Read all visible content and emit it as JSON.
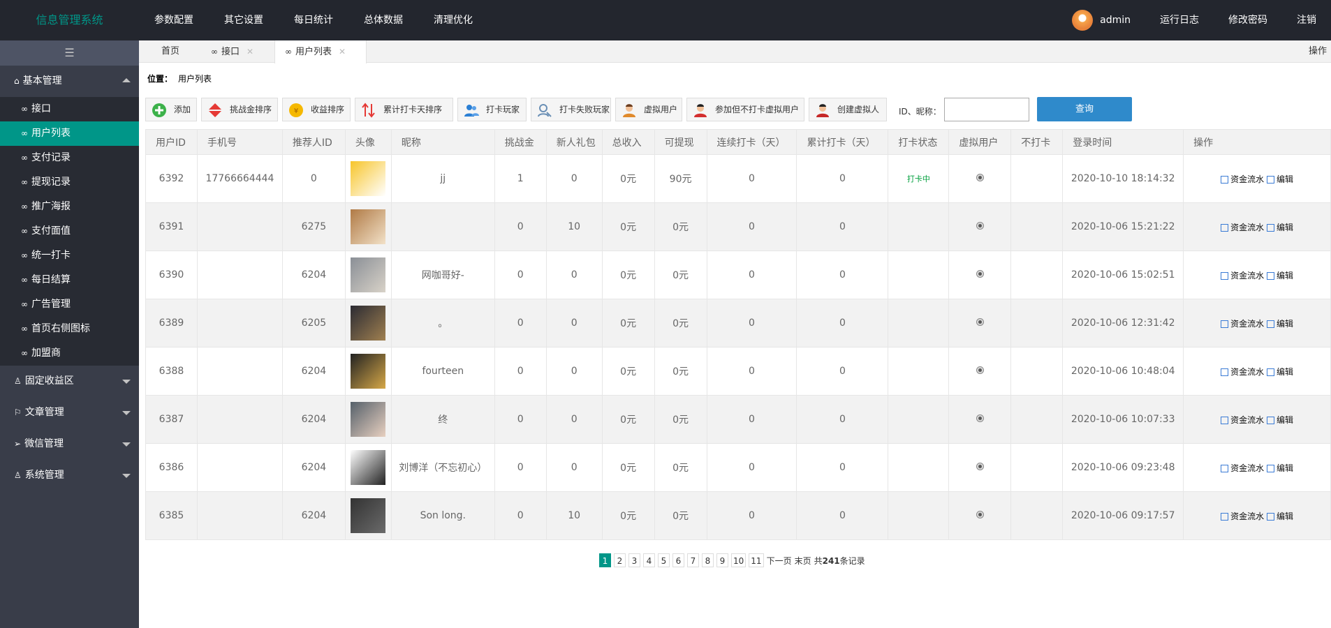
{
  "app": {
    "title": "信息管理系统"
  },
  "topnav": [
    "参数配置",
    "其它设置",
    "每日统计",
    "总体数据",
    "清理优化"
  ],
  "user": {
    "name": "admin"
  },
  "topright": [
    "运行日志",
    "修改密码",
    "注销"
  ],
  "sidebar": {
    "toggle": "☰",
    "groups": [
      {
        "label": "基本管理",
        "items": [
          "接口",
          "用户列表",
          "支付记录",
          "提现记录",
          "推广海报",
          "支付面值",
          "统一打卡",
          "每日结算",
          "广告管理",
          "首页右侧图标",
          "加盟商"
        ]
      },
      {
        "label": "固定收益区"
      },
      {
        "label": "文章管理"
      },
      {
        "label": "微信管理"
      },
      {
        "label": "系统管理"
      }
    ]
  },
  "tabs": [
    {
      "label": "首页"
    },
    {
      "label": "接口"
    },
    {
      "label": "用户列表"
    }
  ],
  "tab_op": "操作",
  "location": {
    "label": "位置：",
    "value": "用户列表"
  },
  "toolbar": [
    "添加",
    "挑战金排序",
    "收益排序",
    "累计打卡天排序",
    "打卡玩家",
    "打卡失败玩家",
    "虚拟用户",
    "参加但不打卡虚拟用户",
    "创建虚拟人"
  ],
  "search": {
    "label": "ID、昵称：",
    "value": "",
    "button": "查询"
  },
  "table": {
    "headers": [
      "用户ID",
      "手机号",
      "推荐人ID",
      "头像",
      "昵称",
      "挑战金",
      "新人礼包",
      "总收入",
      "可提现",
      "连续打卡（天）",
      "累计打卡（天）",
      "打卡状态",
      "虚拟用户",
      "不打卡",
      "登录时间",
      "操作"
    ],
    "rows": [
      {
        "id": "6392",
        "phone": "17766664444",
        "ref": "0",
        "nick": "jj",
        "deposit": "1",
        "gift": "0",
        "income": "0元",
        "withdraw": "90元",
        "cont": "0",
        "total": "0",
        "status": "打卡中",
        "login": "2020-10-10 18:14:32"
      },
      {
        "id": "6391",
        "phone": "",
        "ref": "6275",
        "nick": "",
        "deposit": "0",
        "gift": "10",
        "income": "0元",
        "withdraw": "0元",
        "cont": "0",
        "total": "0",
        "status": "",
        "login": "2020-10-06 15:21:22"
      },
      {
        "id": "6390",
        "phone": "",
        "ref": "6204",
        "nick": "网咖哥好-",
        "deposit": "0",
        "gift": "0",
        "income": "0元",
        "withdraw": "0元",
        "cont": "0",
        "total": "0",
        "status": "",
        "login": "2020-10-06 15:02:51"
      },
      {
        "id": "6389",
        "phone": "",
        "ref": "6205",
        "nick": "。",
        "deposit": "0",
        "gift": "0",
        "income": "0元",
        "withdraw": "0元",
        "cont": "0",
        "total": "0",
        "status": "",
        "login": "2020-10-06 12:31:42"
      },
      {
        "id": "6388",
        "phone": "",
        "ref": "6204",
        "nick": "fourteen",
        "deposit": "0",
        "gift": "0",
        "income": "0元",
        "withdraw": "0元",
        "cont": "0",
        "total": "0",
        "status": "",
        "login": "2020-10-06 10:48:04"
      },
      {
        "id": "6387",
        "phone": "",
        "ref": "6204",
        "nick": "终",
        "deposit": "0",
        "gift": "0",
        "income": "0元",
        "withdraw": "0元",
        "cont": "0",
        "total": "0",
        "status": "",
        "login": "2020-10-06 10:07:33"
      },
      {
        "id": "6386",
        "phone": "",
        "ref": "6204",
        "nick": "刘博洋（不忘初心）",
        "deposit": "0",
        "gift": "0",
        "income": "0元",
        "withdraw": "0元",
        "cont": "0",
        "total": "0",
        "status": "",
        "login": "2020-10-06 09:23:48"
      },
      {
        "id": "6385",
        "phone": "",
        "ref": "6204",
        "nick": "Son long.",
        "deposit": "0",
        "gift": "10",
        "income": "0元",
        "withdraw": "0元",
        "cont": "0",
        "total": "0",
        "status": "",
        "login": "2020-10-06 09:17:57"
      }
    ],
    "op_flow": "资金流水",
    "op_edit": "编辑"
  },
  "pager": {
    "pages": [
      "1",
      "2",
      "3",
      "4",
      "5",
      "6",
      "7",
      "8",
      "9",
      "10",
      "11"
    ],
    "next": "下一页",
    "last": "末页",
    "total_pre": "共",
    "total": "241",
    "total_post": "条记录"
  },
  "colors": {
    "accent": "#009688",
    "topbar": "#23262e",
    "sidebar": "#393d49",
    "query_button": "#2f8acb"
  }
}
